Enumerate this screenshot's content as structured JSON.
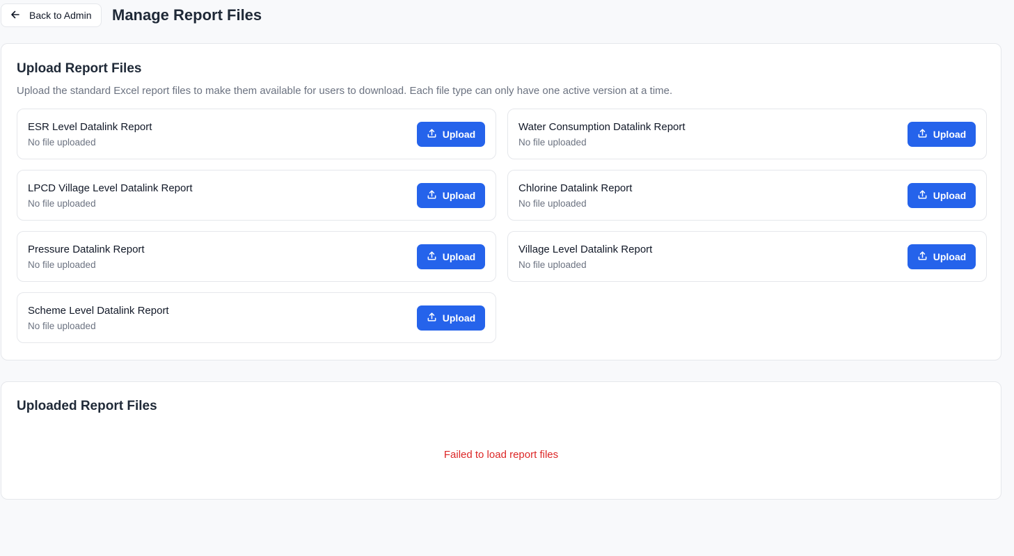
{
  "header": {
    "back_label": "Back to Admin",
    "title": "Manage Report Files"
  },
  "upload_section": {
    "title": "Upload Report Files",
    "description": "Upload the standard Excel report files to make them available for users to download. Each file type can only have one active version at a time.",
    "upload_label": "Upload",
    "files": [
      {
        "name": "ESR Level Datalink Report",
        "status": "No file uploaded"
      },
      {
        "name": "Water Consumption Datalink Report",
        "status": "No file uploaded"
      },
      {
        "name": "LPCD Village Level Datalink Report",
        "status": "No file uploaded"
      },
      {
        "name": "Chlorine Datalink Report",
        "status": "No file uploaded"
      },
      {
        "name": "Pressure Datalink Report",
        "status": "No file uploaded"
      },
      {
        "name": "Village Level Datalink Report",
        "status": "No file uploaded"
      },
      {
        "name": "Scheme Level Datalink Report",
        "status": "No file uploaded"
      }
    ]
  },
  "uploaded_section": {
    "title": "Uploaded Report Files",
    "error": "Failed to load report files"
  },
  "icons": {
    "back": "arrow-left-icon",
    "upload": "upload-icon"
  },
  "colors": {
    "accent": "#2563eb",
    "error": "#dc2626"
  }
}
